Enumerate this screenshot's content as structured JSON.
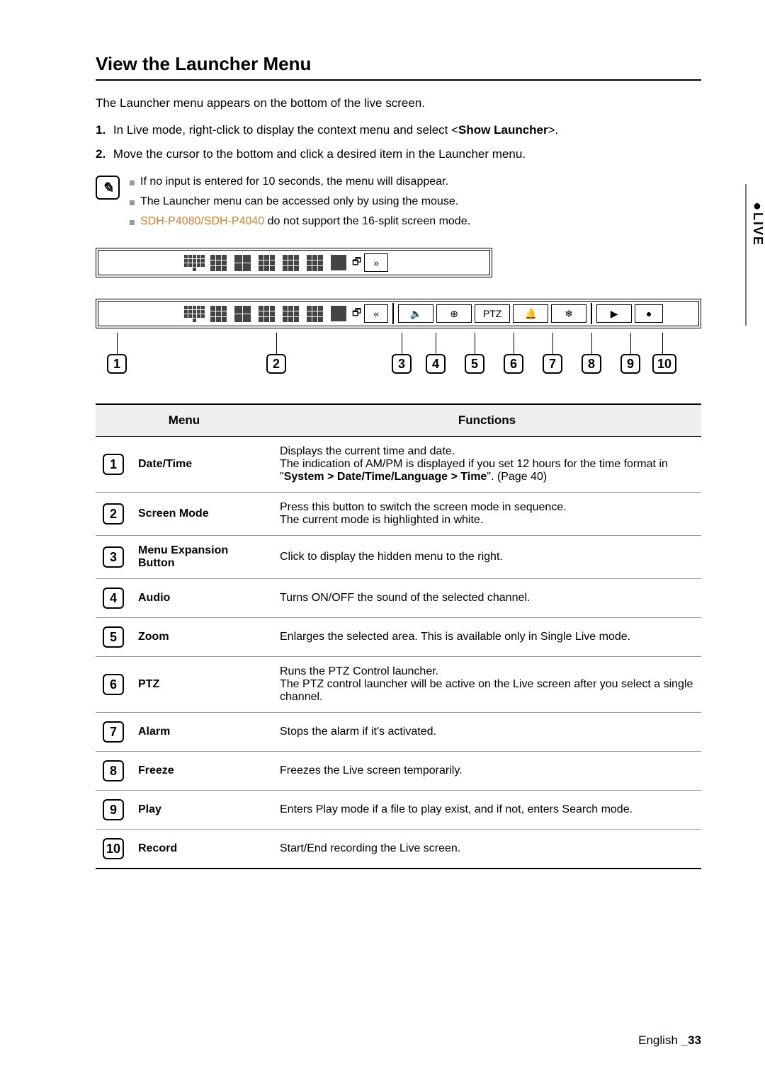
{
  "sideTab": "LIVE",
  "title": "View the Launcher Menu",
  "intro": "The Launcher menu appears on the bottom of the live screen.",
  "steps": [
    {
      "n": "1.",
      "pre": "In Live mode, right-click to display the context menu and select <",
      "bold": "Show Launcher",
      "post": ">."
    },
    {
      "n": "2.",
      "pre": "Move the cursor to the bottom and click a desired item in the Launcher menu.",
      "bold": "",
      "post": ""
    }
  ],
  "notes": [
    {
      "text": "If no input is entered for 10 seconds, the menu will disappear."
    },
    {
      "text": "The Launcher menu can be accessed only by using the mouse."
    },
    {
      "hl": "SDH-P4080/SDH-P4040",
      "rest": " do not support the 16-split screen mode."
    }
  ],
  "tableHead": {
    "menu": "Menu",
    "func": "Functions"
  },
  "rows": [
    {
      "n": "1",
      "menu": "Date/Time",
      "func_pre": "Displays the current time and date.\nThe indication of AM/PM is displayed if you set 12 hours for the time format in \"",
      "func_bold": "System > Date/Time/Language > Time",
      "func_post": "\". (Page 40)"
    },
    {
      "n": "2",
      "menu": "Screen Mode",
      "func": "Press this button to switch the screen mode in sequence.\nThe current mode is highlighted in white."
    },
    {
      "n": "3",
      "menu": "Menu Expansion Button",
      "func": "Click to display the hidden menu to the right."
    },
    {
      "n": "4",
      "menu": "Audio",
      "func": "Turns ON/OFF the sound of the selected channel."
    },
    {
      "n": "5",
      "menu": "Zoom",
      "func": "Enlarges the selected area. This is available only in Single Live mode."
    },
    {
      "n": "6",
      "menu": "PTZ",
      "func": "Runs the PTZ Control launcher.\nThe PTZ control launcher will be active on the Live screen after you select a single channel."
    },
    {
      "n": "7",
      "menu": "Alarm",
      "func": "Stops the alarm if it's activated."
    },
    {
      "n": "8",
      "menu": "Freeze",
      "func": "Freezes the Live screen temporarily."
    },
    {
      "n": "9",
      "menu": "Play",
      "func": "Enters Play mode if a file to play exist, and if not, enters Search mode."
    },
    {
      "n": "10",
      "menu": "Record",
      "func": "Start/End recording the Live screen."
    }
  ],
  "callouts": [
    "1",
    "2",
    "3",
    "4",
    "5",
    "6",
    "7",
    "8",
    "9",
    "10"
  ],
  "footer": {
    "lang": "English ",
    "page": "_33"
  }
}
